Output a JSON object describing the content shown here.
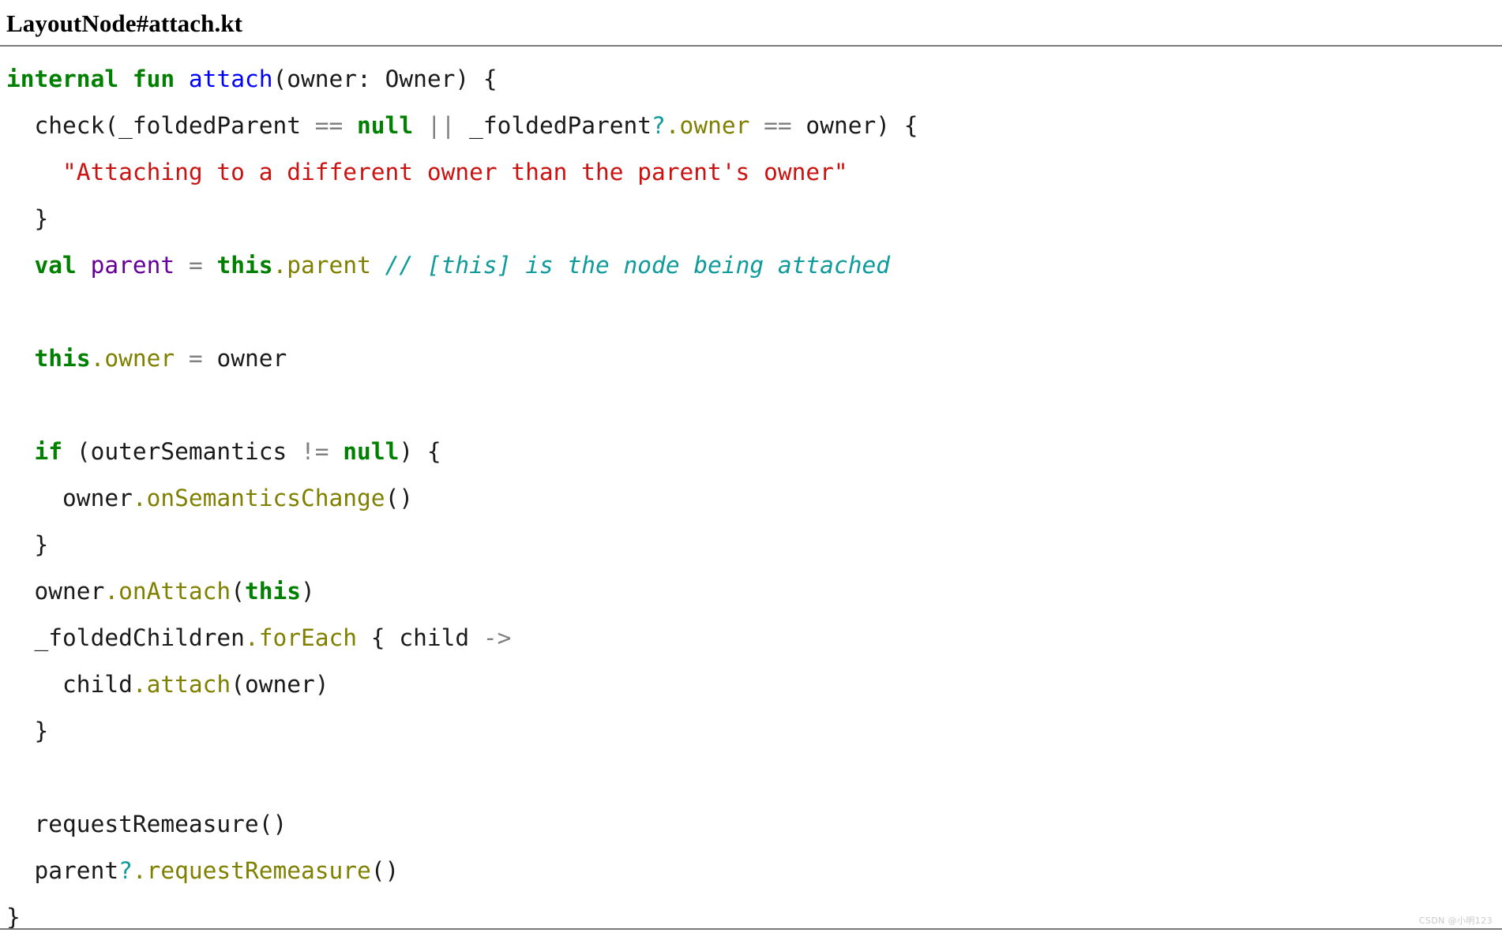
{
  "document": {
    "title": "LayoutNode#attach.kt",
    "language": "kotlin",
    "watermark": "CSDN @小明123"
  },
  "colors": {
    "keyword": "#008000",
    "function_declaration": "#0000ff",
    "property": "#808000",
    "operator": "#808080",
    "string": "#cc1111",
    "comment": "#0f9b9b",
    "variable": "#660099",
    "plain": "#000000",
    "rule": "#7a7a7a",
    "background": "#ffffff"
  },
  "code": {
    "lines": [
      {
        "index": 1,
        "text": "internal fun attach(owner: Owner) {",
        "tokens": [
          {
            "t": "internal",
            "c": "kw"
          },
          {
            "t": " ",
            "c": "pl"
          },
          {
            "t": "fun",
            "c": "kw"
          },
          {
            "t": " ",
            "c": "pl"
          },
          {
            "t": "attach",
            "c": "fn"
          },
          {
            "t": "(owner: Owner) {",
            "c": "pl"
          }
        ]
      },
      {
        "index": 2,
        "text": "  check(_foldedParent == null || _foldedParent?.owner == owner) {",
        "tokens": [
          {
            "t": "  check(_foldedParent ",
            "c": "pl"
          },
          {
            "t": "==",
            "c": "op"
          },
          {
            "t": " ",
            "c": "pl"
          },
          {
            "t": "null",
            "c": "kw"
          },
          {
            "t": " ",
            "c": "pl"
          },
          {
            "t": "||",
            "c": "op"
          },
          {
            "t": " _foldedParent",
            "c": "pl"
          },
          {
            "t": "?",
            "c": "q"
          },
          {
            "t": ".owner",
            "c": "prop"
          },
          {
            "t": " ",
            "c": "pl"
          },
          {
            "t": "==",
            "c": "op"
          },
          {
            "t": " owner) {",
            "c": "pl"
          }
        ]
      },
      {
        "index": 3,
        "text": "    \"Attaching to a different owner than the parent's owner\"",
        "tokens": [
          {
            "t": "    ",
            "c": "pl"
          },
          {
            "t": "\"Attaching to a different owner than the parent's owner\"",
            "c": "str"
          }
        ]
      },
      {
        "index": 4,
        "text": "  }",
        "tokens": [
          {
            "t": "  }",
            "c": "pl"
          }
        ]
      },
      {
        "index": 5,
        "text": "  val parent = this.parent // [this] is the node being attached",
        "tokens": [
          {
            "t": "  ",
            "c": "pl"
          },
          {
            "t": "val",
            "c": "kw"
          },
          {
            "t": " ",
            "c": "pl"
          },
          {
            "t": "parent",
            "c": "var"
          },
          {
            "t": " ",
            "c": "pl"
          },
          {
            "t": "=",
            "c": "op"
          },
          {
            "t": " ",
            "c": "pl"
          },
          {
            "t": "this",
            "c": "kw"
          },
          {
            "t": ".parent",
            "c": "prop"
          },
          {
            "t": " ",
            "c": "pl"
          },
          {
            "t": "// [this] is the node being attached",
            "c": "cmt"
          }
        ]
      },
      {
        "index": 6,
        "text": "",
        "tokens": []
      },
      {
        "index": 7,
        "text": "  this.owner = owner",
        "tokens": [
          {
            "t": "  ",
            "c": "pl"
          },
          {
            "t": "this",
            "c": "kw"
          },
          {
            "t": ".owner",
            "c": "prop"
          },
          {
            "t": " ",
            "c": "pl"
          },
          {
            "t": "=",
            "c": "op"
          },
          {
            "t": " owner",
            "c": "pl"
          }
        ]
      },
      {
        "index": 8,
        "text": "",
        "tokens": []
      },
      {
        "index": 9,
        "text": "  if (outerSemantics != null) {",
        "tokens": [
          {
            "t": "  ",
            "c": "pl"
          },
          {
            "t": "if",
            "c": "kw"
          },
          {
            "t": " (outerSemantics ",
            "c": "pl"
          },
          {
            "t": "!=",
            "c": "op"
          },
          {
            "t": " ",
            "c": "pl"
          },
          {
            "t": "null",
            "c": "kw"
          },
          {
            "t": ") {",
            "c": "pl"
          }
        ]
      },
      {
        "index": 10,
        "text": "    owner.onSemanticsChange()",
        "tokens": [
          {
            "t": "    owner",
            "c": "pl"
          },
          {
            "t": ".onSemanticsChange",
            "c": "prop"
          },
          {
            "t": "()",
            "c": "pl"
          }
        ]
      },
      {
        "index": 11,
        "text": "  }",
        "tokens": [
          {
            "t": "  }",
            "c": "pl"
          }
        ]
      },
      {
        "index": 12,
        "text": "  owner.onAttach(this)",
        "tokens": [
          {
            "t": "  owner",
            "c": "pl"
          },
          {
            "t": ".onAttach",
            "c": "prop"
          },
          {
            "t": "(",
            "c": "pl"
          },
          {
            "t": "this",
            "c": "kw"
          },
          {
            "t": ")",
            "c": "pl"
          }
        ]
      },
      {
        "index": 13,
        "text": "  _foldedChildren.forEach { child ->",
        "tokens": [
          {
            "t": "  _foldedChildren",
            "c": "pl"
          },
          {
            "t": ".forEach",
            "c": "prop"
          },
          {
            "t": " { child ",
            "c": "pl"
          },
          {
            "t": "->",
            "c": "op"
          }
        ]
      },
      {
        "index": 14,
        "text": "    child.attach(owner)",
        "tokens": [
          {
            "t": "    child",
            "c": "pl"
          },
          {
            "t": ".attach",
            "c": "prop"
          },
          {
            "t": "(owner)",
            "c": "pl"
          }
        ]
      },
      {
        "index": 15,
        "text": "  }",
        "tokens": [
          {
            "t": "  }",
            "c": "pl"
          }
        ]
      },
      {
        "index": 16,
        "text": "",
        "tokens": []
      },
      {
        "index": 17,
        "text": "  requestRemeasure()",
        "tokens": [
          {
            "t": "  requestRemeasure()",
            "c": "pl"
          }
        ]
      },
      {
        "index": 18,
        "text": "  parent?.requestRemeasure()",
        "tokens": [
          {
            "t": "  parent",
            "c": "pl"
          },
          {
            "t": "?",
            "c": "q"
          },
          {
            "t": ".requestRemeasure",
            "c": "prop"
          },
          {
            "t": "()",
            "c": "pl"
          }
        ]
      },
      {
        "index": 19,
        "text": "}",
        "tokens": [
          {
            "t": "}",
            "c": "pl"
          }
        ]
      }
    ]
  }
}
